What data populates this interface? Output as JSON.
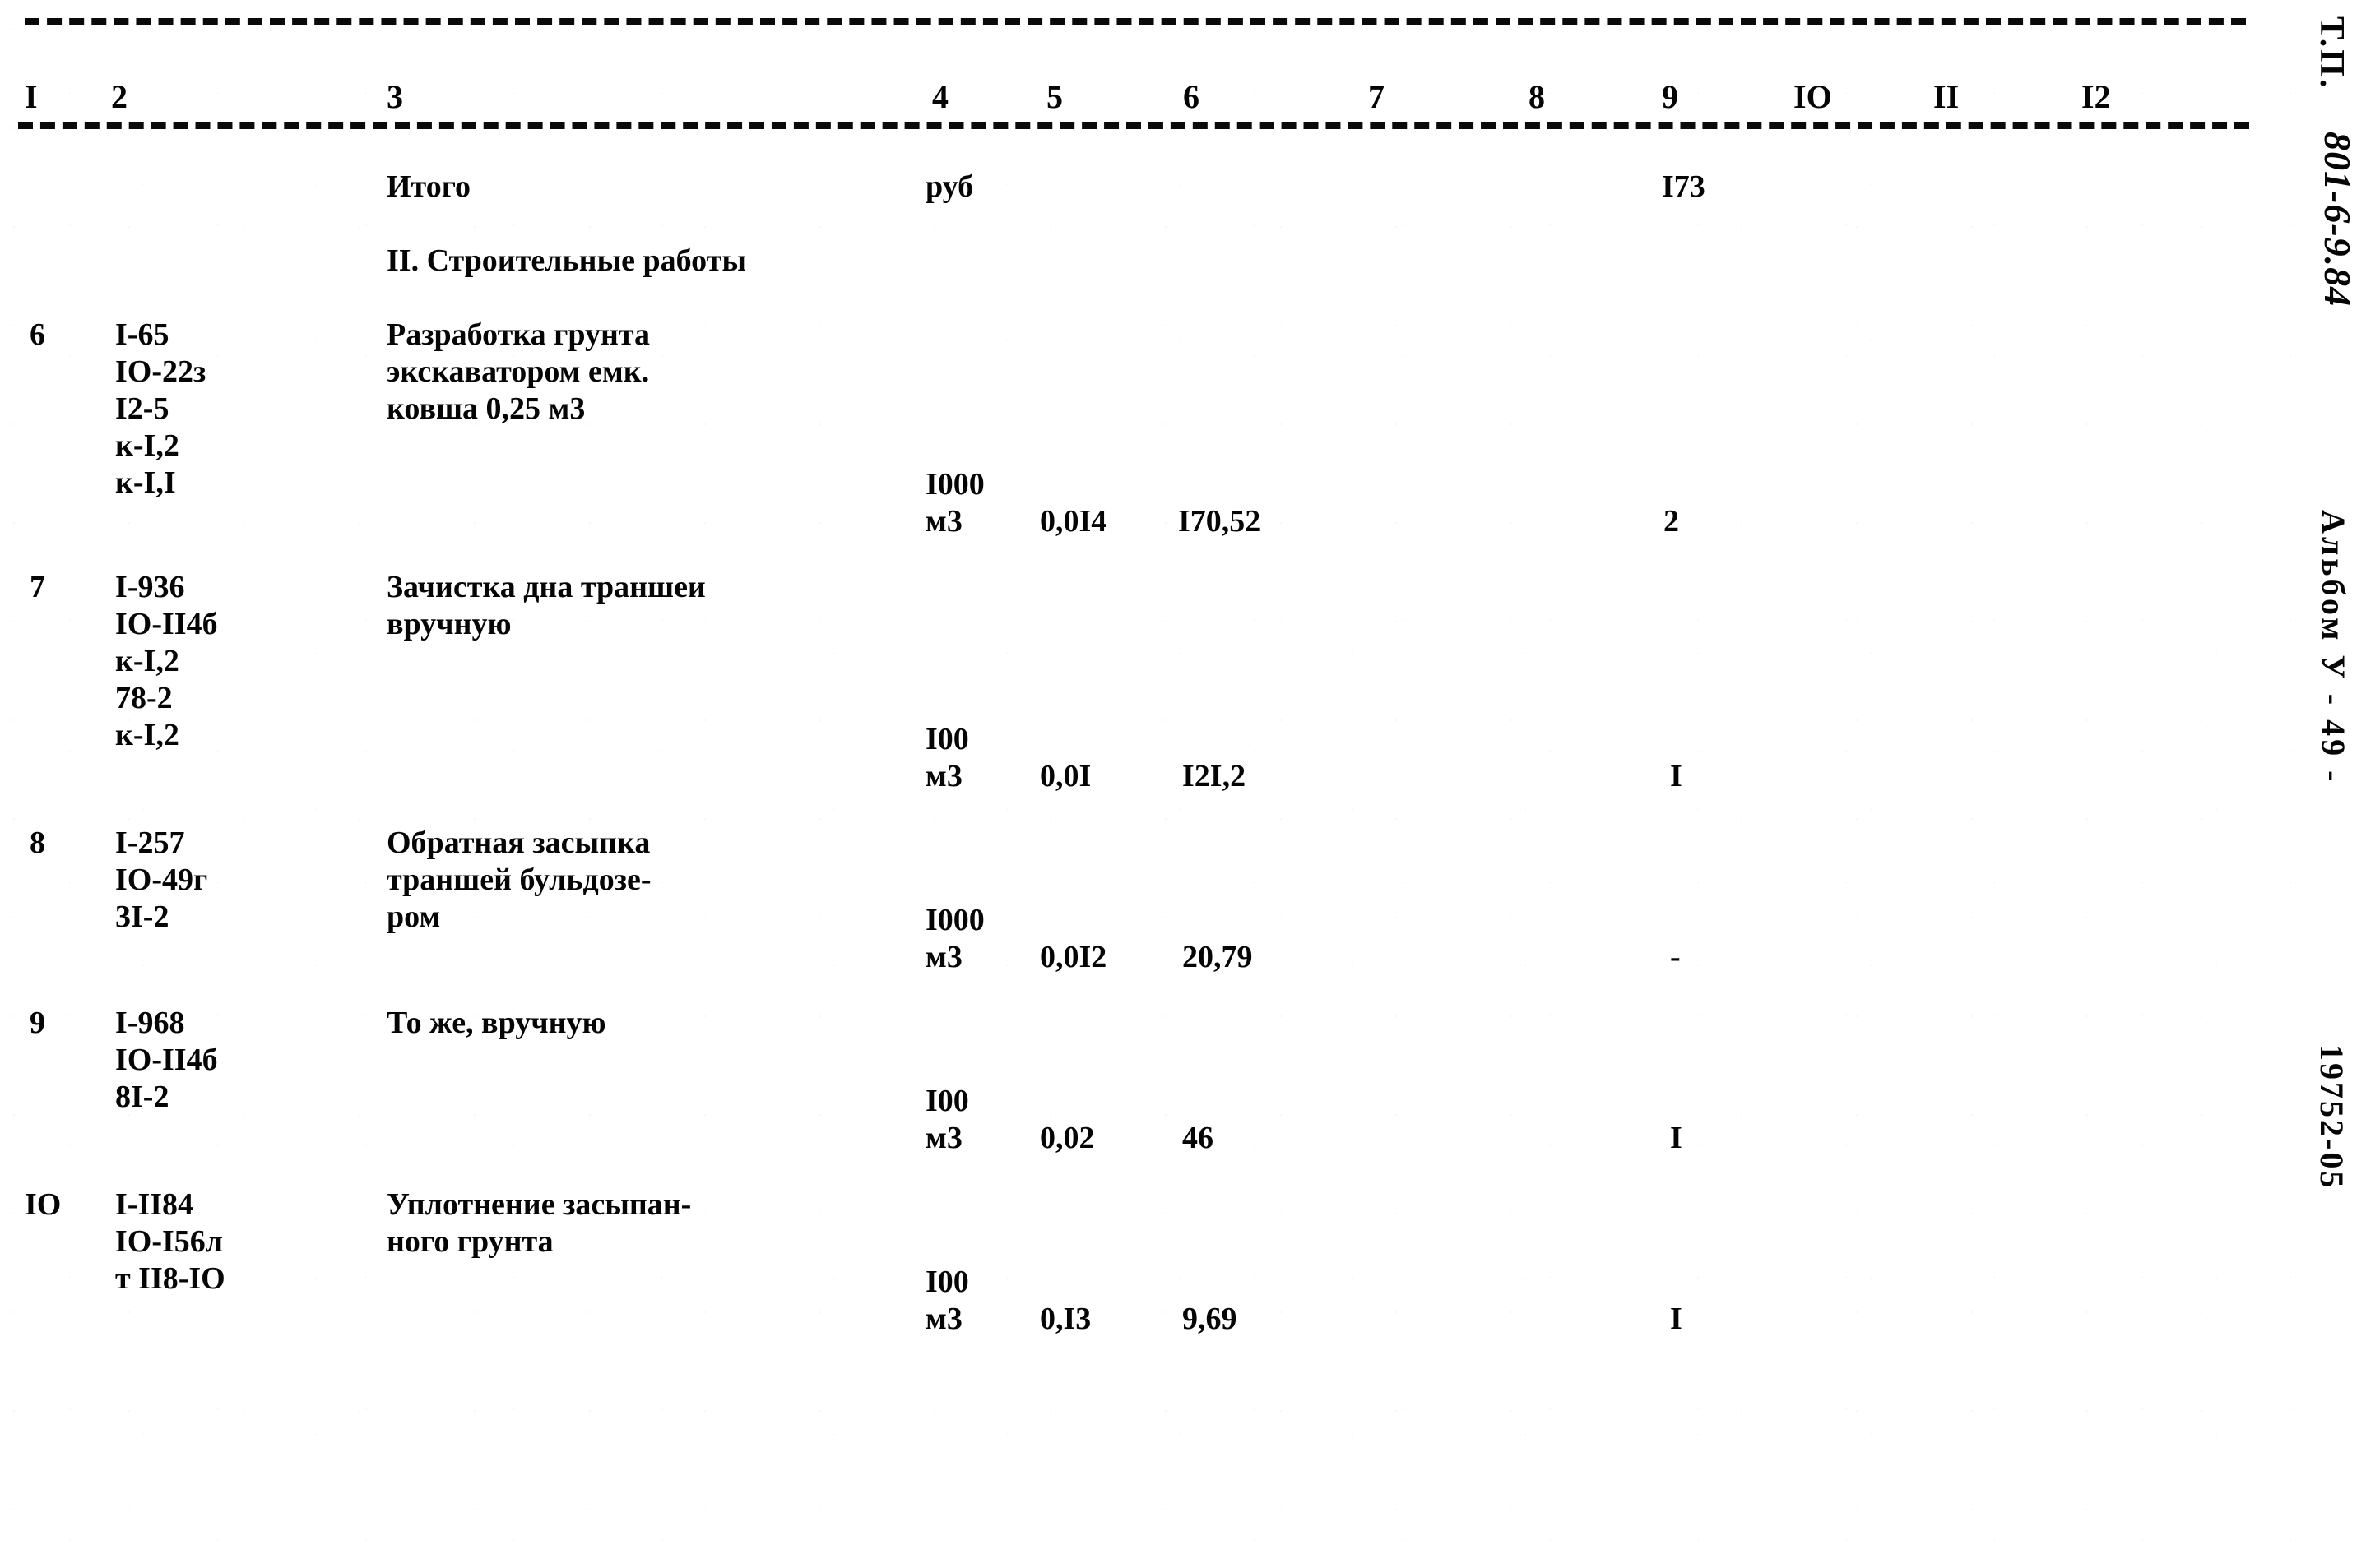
{
  "document": {
    "type": "scanned-estimate-table",
    "margin": {
      "type_designation": "Т.П.",
      "project_code": "801-6-9.84",
      "album": "Альбом У - 49 -",
      "doc_number": "19752-05"
    }
  },
  "table": {
    "column_numbers": [
      "I",
      "2",
      "3",
      "4",
      "5",
      "6",
      "7",
      "8",
      "9",
      "IO",
      "II",
      "I2"
    ],
    "rows": [
      {
        "no": "",
        "codes": "",
        "description": "Итого",
        "unit": "руб",
        "qty": "",
        "price": "",
        "col7": "",
        "col8": "",
        "col9": "I73",
        "col10": "",
        "col11": "",
        "col12": ""
      },
      {
        "no": "",
        "codes": "",
        "description": "II. Строительные работы",
        "unit": "",
        "qty": "",
        "price": "",
        "col7": "",
        "col8": "",
        "col9": "",
        "col10": "",
        "col11": "",
        "col12": ""
      },
      {
        "no": "6",
        "codes": "I-65\nIO-22з\nI2-5\nк-I,2\nк-I,I",
        "description": "Разработка грунта\nэкскаватором емк.\nковша 0,25 м3",
        "unit": "I000\nм3",
        "qty": "0,0I4",
        "price": "I70,52",
        "col7": "",
        "col8": "",
        "col9": "2",
        "col10": "",
        "col11": "",
        "col12": ""
      },
      {
        "no": "7",
        "codes": "I-936\nIO-II4б\nк-I,2\n78-2\nк-I,2",
        "description": "Зачистка дна траншеи\nвручную",
        "unit": "I00\nм3",
        "qty": "0,0I",
        "price": "I2I,2",
        "col7": "",
        "col8": "",
        "col9": "I",
        "col10": "",
        "col11": "",
        "col12": ""
      },
      {
        "no": "8",
        "codes": "I-257\nIO-49г\n3I-2",
        "description": "Обратная засыпка\nтраншей бульдозе-\nром",
        "unit": "I000\nм3",
        "qty": "0,0I2",
        "price": "20,79",
        "col7": "",
        "col8": "",
        "col9": "-",
        "col10": "",
        "col11": "",
        "col12": ""
      },
      {
        "no": "9",
        "codes": "I-968\nIO-II4б\n8I-2",
        "description": "То же, вручную",
        "unit": "I00\nм3",
        "qty": "0,02",
        "price": "46",
        "col7": "",
        "col8": "",
        "col9": "I",
        "col10": "",
        "col11": "",
        "col12": ""
      },
      {
        "no": "IO",
        "codes": "I-II84\nIO-I56л\nт II8-IO",
        "description": "Уплотнение засыпан-\nного грунта",
        "unit": "I00\nм3",
        "qty": "0,I3",
        "price": "9,69",
        "col7": "",
        "col8": "",
        "col9": "I",
        "col10": "",
        "col11": "",
        "col12": ""
      }
    ]
  }
}
